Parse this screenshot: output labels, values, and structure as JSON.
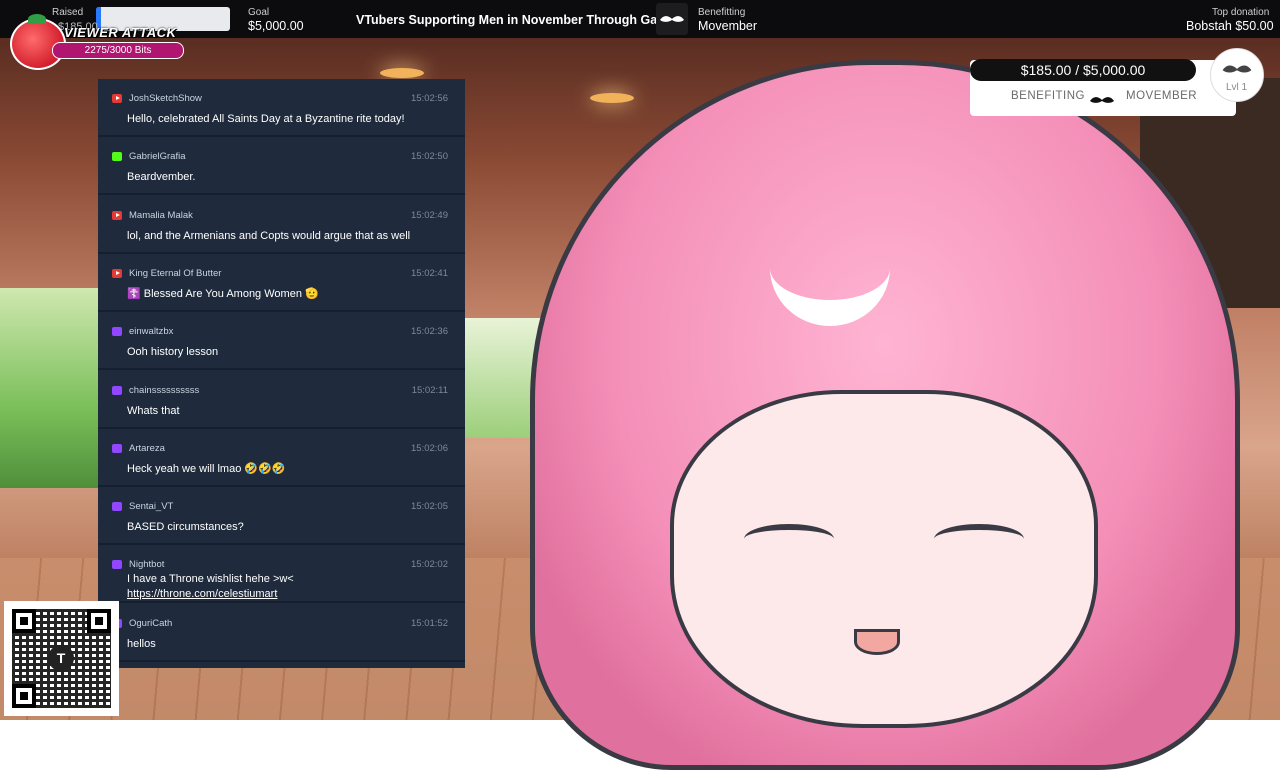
{
  "topbar": {
    "raised_label": "Raised",
    "raised_value": "$185.00",
    "raised_fraction": 0.037,
    "goal_label": "Goal",
    "goal_value": "$5,000.00",
    "campaign_title": "VTubers Supporting Men in November Through Gaming",
    "benefitting_label": "Benefitting",
    "benefitting_value": "Movember",
    "top_donation_label": "Top donation",
    "top_donation_value": "Bobstah $50.00"
  },
  "viewer_attack": {
    "title": "VIEWER ATTACK",
    "bits": "2275/3000 Bits"
  },
  "chat": {
    "messages": [
      {
        "platform": "youtube",
        "user": "JoshSketchShow",
        "time": "15:02:56",
        "text": "Hello, celebrated All Saints Day at a Byzantine rite today!"
      },
      {
        "platform": "kick",
        "user": "GabrielGrafia",
        "time": "15:02:50",
        "text": "Beardvember."
      },
      {
        "platform": "youtube",
        "user": "Mamalia Malak",
        "time": "15:02:49",
        "text": "lol, and the Armenians and Copts would argue that as well"
      },
      {
        "platform": "youtube",
        "user": "King Eternal Of Butter",
        "time": "15:02:41",
        "text": "☦️ Blessed Are You Among Women 🫡"
      },
      {
        "platform": "twitch",
        "user": "einwaltzbx",
        "time": "15:02:36",
        "text": "Ooh history lesson"
      },
      {
        "platform": "twitch",
        "user": "chainssssssssss",
        "time": "15:02:11",
        "text": "Whats that"
      },
      {
        "platform": "twitch",
        "user": "Artareza",
        "time": "15:02:06",
        "text": "Heck yeah we will lmao 🤣🤣🤣"
      },
      {
        "platform": "twitch",
        "user": "Sentai_VT",
        "time": "15:02:05",
        "text": "BASED circumstances?"
      },
      {
        "platform": "twitch",
        "user": "Nightbot",
        "time": "15:02:02",
        "text": "I have a Throne wishlist hehe >w<",
        "link": "https://throne.com/celestiumart"
      },
      {
        "platform": "twitch",
        "user": "OguriCath",
        "time": "15:01:52",
        "text": "hellos"
      }
    ]
  },
  "donation_widget": {
    "progress": "$185.00 / $5,000.00",
    "benefiting": "BENEFITING",
    "charity": "MOVEMBER",
    "level": "Lvl 1"
  },
  "colors": {
    "youtube": "#e53935",
    "twitch": "#9146ff",
    "kick": "#53fc18",
    "chat_bg": "#1f2b3c",
    "bits_bar": "#b01670"
  },
  "icons": {
    "mustache": "mustache-icon",
    "qr": "qr-code-icon",
    "tomato": "tomato-heart-icon"
  }
}
